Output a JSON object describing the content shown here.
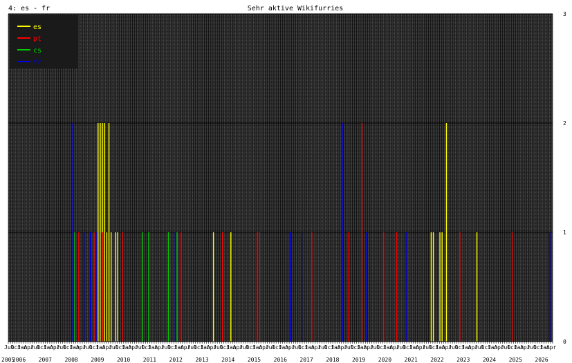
{
  "window": {
    "corner_label": "4: es - fr"
  },
  "chart_data": {
    "type": "bar",
    "title": "Sehr aktive Wikifurries",
    "xlabel": "",
    "ylabel": "",
    "ylim": [
      0,
      3
    ],
    "yticks": [
      "0",
      "1",
      "2",
      "3"
    ],
    "x_start": "2005-07",
    "x_end": "2026-05",
    "month_tick_labels": [
      "Jul",
      "Oct",
      "Jan",
      "Apr"
    ],
    "year_labels": [
      "2005",
      "2006",
      "2007",
      "2008",
      "2009",
      "2010",
      "2011",
      "2012",
      "2013",
      "2014",
      "2015",
      "2016",
      "2017",
      "2018",
      "2019",
      "2020",
      "2021",
      "2022",
      "2023",
      "2024",
      "2025",
      "2026"
    ],
    "grid": true,
    "legend_position": "top-left",
    "colors": {
      "background": "#2b2b2b",
      "grid": "#000000",
      "es": "#ffff00",
      "pt": "#ff0000",
      "cs": "#00cc00",
      "fr": "#0000ff"
    },
    "series": [
      {
        "name": "es",
        "color": "#ffff00",
        "points": [
          [
            "2008-12",
            2
          ],
          [
            "2009-01",
            2
          ],
          [
            "2009-02",
            2
          ],
          [
            "2009-03",
            2
          ],
          [
            "2009-04",
            1
          ],
          [
            "2009-05",
            2
          ],
          [
            "2009-06",
            1
          ],
          [
            "2009-08",
            1
          ],
          [
            "2009-09",
            1
          ],
          [
            "2013-05",
            1
          ],
          [
            "2014-01",
            1
          ],
          [
            "2021-09",
            1
          ],
          [
            "2021-10",
            1
          ],
          [
            "2022-01",
            1
          ],
          [
            "2022-02",
            1
          ],
          [
            "2022-04",
            2
          ],
          [
            "2023-06",
            1
          ]
        ]
      },
      {
        "name": "pt",
        "color": "#ff0000",
        "points": [
          [
            "2008-03",
            1
          ],
          [
            "2008-10",
            1
          ],
          [
            "2009-02",
            1
          ],
          [
            "2009-11",
            1
          ],
          [
            "2012-02",
            1
          ],
          [
            "2013-09",
            1
          ],
          [
            "2015-01",
            1
          ],
          [
            "2015-02",
            1
          ],
          [
            "2017-02",
            1
          ],
          [
            "2018-07",
            1
          ],
          [
            "2019-01",
            2
          ],
          [
            "2019-11",
            1
          ],
          [
            "2020-05",
            1
          ],
          [
            "2022-10",
            1
          ],
          [
            "2024-10",
            1
          ]
        ]
      },
      {
        "name": "cs",
        "color": "#00cc00",
        "points": [
          [
            "2008-01",
            1
          ],
          [
            "2010-08",
            1
          ],
          [
            "2010-11",
            1
          ],
          [
            "2011-08",
            1
          ],
          [
            "2011-12",
            1
          ]
        ]
      },
      {
        "name": "fr",
        "color": "#0000ff",
        "points": [
          [
            "2007-12",
            2
          ],
          [
            "2008-05",
            1
          ],
          [
            "2008-08",
            1
          ],
          [
            "2008-11",
            1
          ],
          [
            "2009-01",
            1
          ],
          [
            "2009-03",
            1
          ],
          [
            "2011-11",
            1
          ],
          [
            "2016-04",
            1
          ],
          [
            "2016-09",
            1
          ],
          [
            "2018-04",
            2
          ],
          [
            "2019-03",
            1
          ],
          [
            "2020-09",
            1
          ],
          [
            "2026-03",
            1
          ]
        ]
      }
    ]
  }
}
